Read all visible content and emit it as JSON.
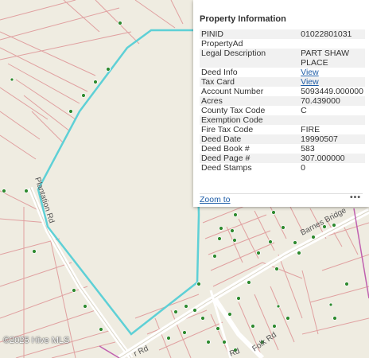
{
  "map": {
    "road_labels": [
      "Plantation Rd",
      "Barnes Bridge",
      "r Rd",
      "Rd",
      "Folk Rd"
    ],
    "watermark": "©2025 Hive MLS",
    "colors": {
      "background": "#efece1",
      "parcel_lines": "#e0a0a0",
      "highlight": "#5ed0d6",
      "roads": "#ffffff",
      "boundary": "#c060b0",
      "trees": "#2f8a2f"
    }
  },
  "popup": {
    "title": "Property Information",
    "rows": [
      {
        "key": "PINID",
        "value": "01022801031"
      },
      {
        "key": "PropertyAd",
        "value": ""
      },
      {
        "key": "Legal Description",
        "value": "PART SHAW PLACE"
      },
      {
        "key": "Deed Info",
        "value": "View",
        "link": true
      },
      {
        "key": "Tax Card",
        "value": "View",
        "link": true
      },
      {
        "key": "Account Number",
        "value": "5093449.000000"
      },
      {
        "key": "Acres",
        "value": "70.439000"
      },
      {
        "key": "County Tax Code",
        "value": "C"
      },
      {
        "key": "Exemption Code",
        "value": ""
      },
      {
        "key": "Fire Tax Code",
        "value": "FIRE"
      },
      {
        "key": "Deed Date",
        "value": "19990507"
      },
      {
        "key": "Deed Book #",
        "value": "583"
      },
      {
        "key": "Deed Page #",
        "value": "307.000000"
      },
      {
        "key": "Deed Stamps",
        "value": "0"
      }
    ],
    "zoom_label": "Zoom to",
    "more_label": "•••"
  }
}
